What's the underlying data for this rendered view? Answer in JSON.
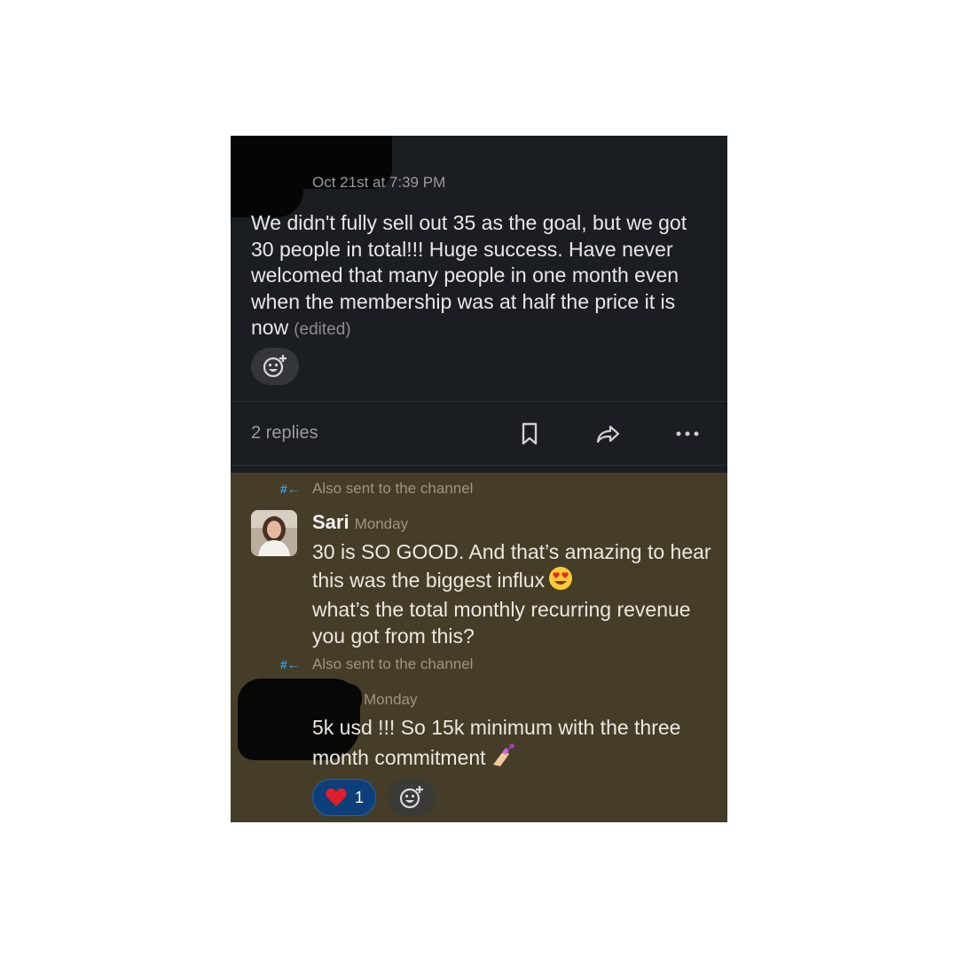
{
  "parent_message": {
    "timestamp": "Oct 21st at 7:39 PM",
    "text": "We didn't fully sell out 35 as the goal, but we got 30 people in total!!! Huge success. Have never welcomed that many people in one month even when the membership was at half the price it is now",
    "edited_label": "(edited)",
    "add_reaction_icon": "add-reaction-icon"
  },
  "actions": {
    "replies_label": "2 replies",
    "icons": [
      "bookmark-icon",
      "share-icon",
      "more-icon"
    ]
  },
  "thread": {
    "highlight_color": "#453d28",
    "also_sent_label": "Also sent to the channel",
    "also_sent_icon": "#←",
    "messages": [
      {
        "author": "Sari",
        "time": "Monday",
        "text": "30 is SO GOOD. And that’s amazing to hear this was the biggest influx",
        "emoji": "heart-eyes-emoji",
        "text_after": "what’s the total monthly recurring revenue you got from this?"
      },
      {
        "author": "",
        "time": "Monday",
        "text": "5k usd !!! So 15k minimum with the three month commitment",
        "emoji": "nail-polish-emoji",
        "reaction": {
          "emoji": "heart-emoji",
          "count": "1"
        }
      }
    ]
  },
  "colors": {
    "background": "#1a1d21",
    "reaction_bg": "#0d3f7a",
    "accent_blue": "#3aa3e3"
  }
}
